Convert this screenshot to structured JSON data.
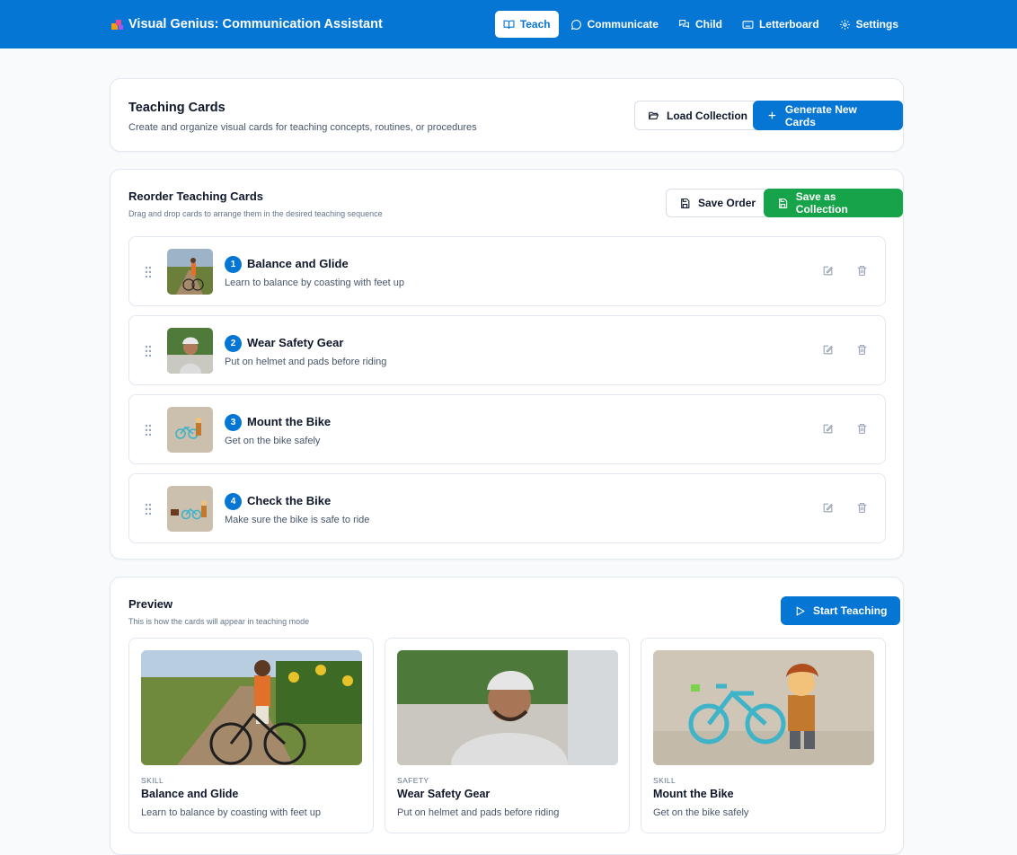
{
  "app": {
    "title": "Visual Genius: Communication Assistant",
    "accent": "#0576d4"
  },
  "nav": [
    {
      "label": "Teach",
      "icon": "book-open-icon",
      "active": true
    },
    {
      "label": "Communicate",
      "icon": "message-circle-icon",
      "active": false
    },
    {
      "label": "Child",
      "icon": "messages-icon",
      "active": false
    },
    {
      "label": "Letterboard",
      "icon": "keyboard-icon",
      "active": false
    },
    {
      "label": "Settings",
      "icon": "gear-icon",
      "active": false
    }
  ],
  "header_card": {
    "title": "Teaching Cards",
    "subtitle": "Create and organize visual cards for teaching concepts, routines, or procedures",
    "load_label": "Load Collection",
    "generate_label": "Generate New Cards"
  },
  "reorder": {
    "title": "Reorder Teaching Cards",
    "subtitle": "Drag and drop cards to arrange them in the desired teaching sequence",
    "save_order_label": "Save Order",
    "save_collection_label": "Save as Collection",
    "items": [
      {
        "number": "1",
        "title": "Balance and Glide",
        "description": "Learn to balance by coasting with feet up"
      },
      {
        "number": "2",
        "title": "Wear Safety Gear",
        "description": "Put on helmet and pads before riding"
      },
      {
        "number": "3",
        "title": "Mount the Bike",
        "description": "Get on the bike safely"
      },
      {
        "number": "4",
        "title": "Check the Bike",
        "description": "Make sure the bike is safe to ride"
      }
    ]
  },
  "preview": {
    "title": "Preview",
    "subtitle": "This is how the cards will appear in teaching mode",
    "start_label": "Start Teaching",
    "cards": [
      {
        "category": "SKILL",
        "title": "Balance and Glide",
        "description": "Learn to balance by coasting with feet up"
      },
      {
        "category": "SAFETY",
        "title": "Wear Safety Gear",
        "description": "Put on helmet and pads before riding"
      },
      {
        "category": "SKILL",
        "title": "Mount the Bike",
        "description": "Get on the bike safely"
      }
    ]
  }
}
